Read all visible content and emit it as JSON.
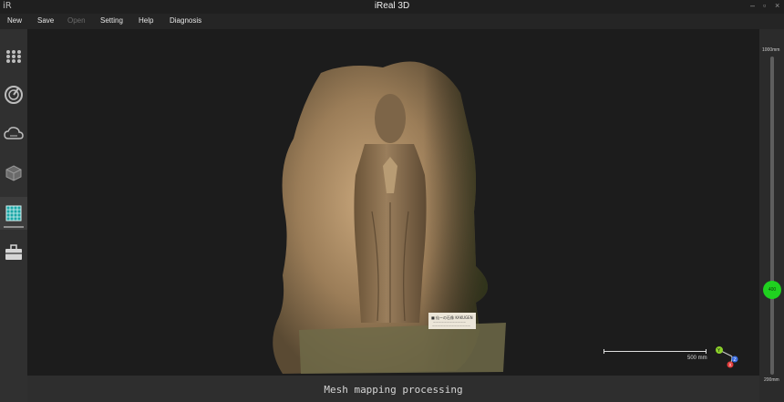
{
  "app": {
    "logo": "iR",
    "title": "iReal 3D"
  },
  "window_controls": {
    "minimize": "–",
    "maximize": "▫",
    "close": "×"
  },
  "menu": [
    {
      "label": "New",
      "enabled": true
    },
    {
      "label": "Save",
      "enabled": true
    },
    {
      "label": "Open",
      "enabled": false
    },
    {
      "label": "Setting",
      "enabled": true
    },
    {
      "label": "Help",
      "enabled": true
    },
    {
      "label": "Diagnosis",
      "enabled": true
    }
  ],
  "sidebar": {
    "items": [
      {
        "icon": "grid-dots-icon",
        "active": false
      },
      {
        "icon": "scan-dial-icon",
        "active": false
      },
      {
        "icon": "cloud-icon",
        "active": false
      },
      {
        "icon": "mesh-cube-icon",
        "active": false
      },
      {
        "icon": "texture-grid-icon",
        "active": true
      },
      {
        "icon": "toolbox-icon",
        "active": false
      }
    ]
  },
  "viewport": {
    "plaque": {
      "line1": "■ 仙ーの石像  KAKUGEN",
      "line2": "ーーーーーーーーーーーー",
      "line3": "ーーーーーーーーーーーーーー"
    },
    "scale": {
      "label": "500 mm"
    },
    "axes": {
      "y": "Y",
      "z": "Z",
      "x": "X",
      "colors": {
        "x": "#e23b3b",
        "y": "#8bd12a",
        "z": "#3b6ee2"
      }
    }
  },
  "depth_slider": {
    "max_label": "1000mm",
    "min_label": "200mm",
    "value_label": "400",
    "value_mm": 400,
    "min_mm": 200,
    "max_mm": 1000,
    "color": "#1fd11f"
  },
  "status": {
    "text": "Mesh mapping processing"
  }
}
